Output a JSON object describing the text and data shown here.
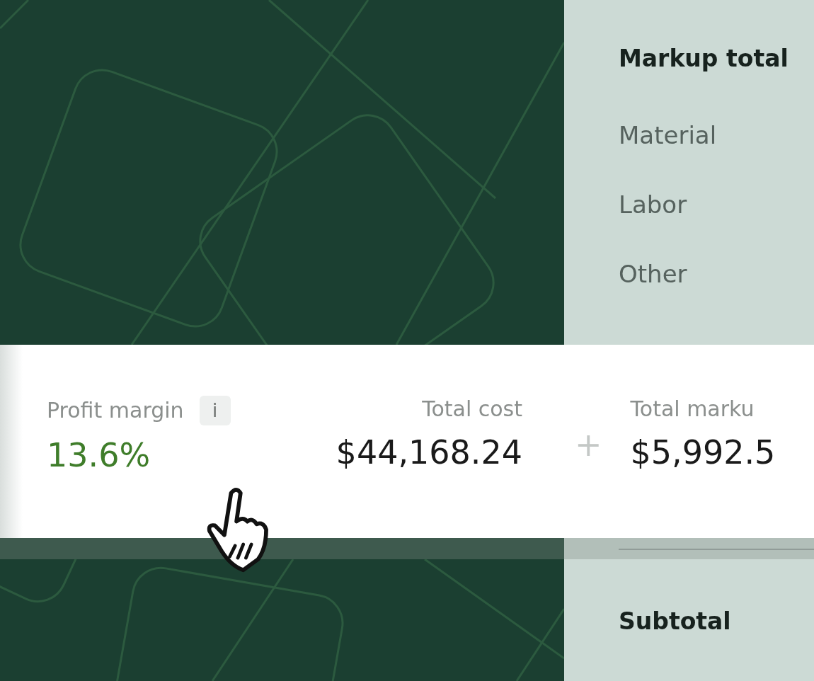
{
  "markup_panel": {
    "heading": "Markup total",
    "items": [
      "Material",
      "Labor",
      "Other"
    ],
    "subtotal": "Subtotal"
  },
  "summary": {
    "profit_margin": {
      "label": "Profit margin",
      "info": "i",
      "value": "13.6%"
    },
    "total_cost": {
      "label": "Total cost",
      "value": "$44,168.24"
    },
    "operator": "+",
    "total_markup": {
      "label": "Total marku",
      "value": "$5,992.5"
    }
  }
}
